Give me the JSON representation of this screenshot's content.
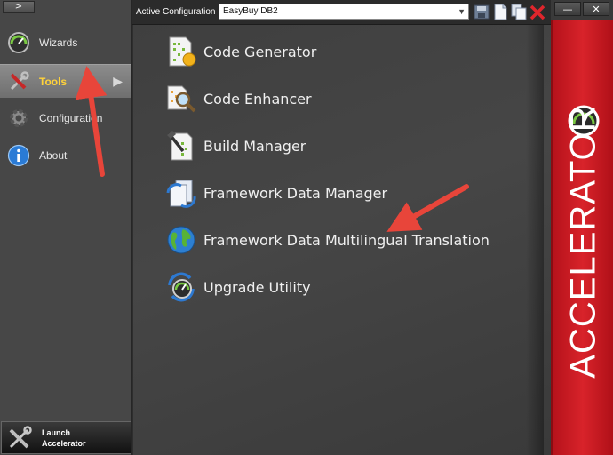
{
  "sidebar": {
    "collapse_label": ">",
    "items": [
      {
        "label": "Wizards",
        "icon": "wizards-icon"
      },
      {
        "label": "Tools",
        "icon": "tools-icon",
        "active": true
      },
      {
        "label": "Configuration",
        "icon": "gear-icon"
      },
      {
        "label": "About",
        "icon": "info-icon"
      }
    ],
    "launch": {
      "label": "Launch\nAccelerator",
      "icon": "tools-icon"
    }
  },
  "topbar": {
    "config_label": "Active Configuration",
    "config_value": "EasyBuy DB2",
    "buttons": [
      "save-icon",
      "new-document-icon",
      "copy-icon",
      "delete-icon"
    ]
  },
  "window": {
    "minimize": "—",
    "close": "✕"
  },
  "tools": [
    {
      "label": "Code Generator",
      "icon": "code-generator-icon"
    },
    {
      "label": "Code Enhancer",
      "icon": "code-enhancer-icon"
    },
    {
      "label": "Build Manager",
      "icon": "build-manager-icon"
    },
    {
      "label": "Framework Data Manager",
      "icon": "framework-data-manager-icon"
    },
    {
      "label": "Framework Data Multilingual Translation",
      "icon": "globe-icon"
    },
    {
      "label": "Upgrade Utility",
      "icon": "upgrade-utility-icon"
    }
  ],
  "brand": {
    "text": "ACCELERATOR",
    "color": "#d8232a"
  },
  "annotation_color": "#e8453a"
}
